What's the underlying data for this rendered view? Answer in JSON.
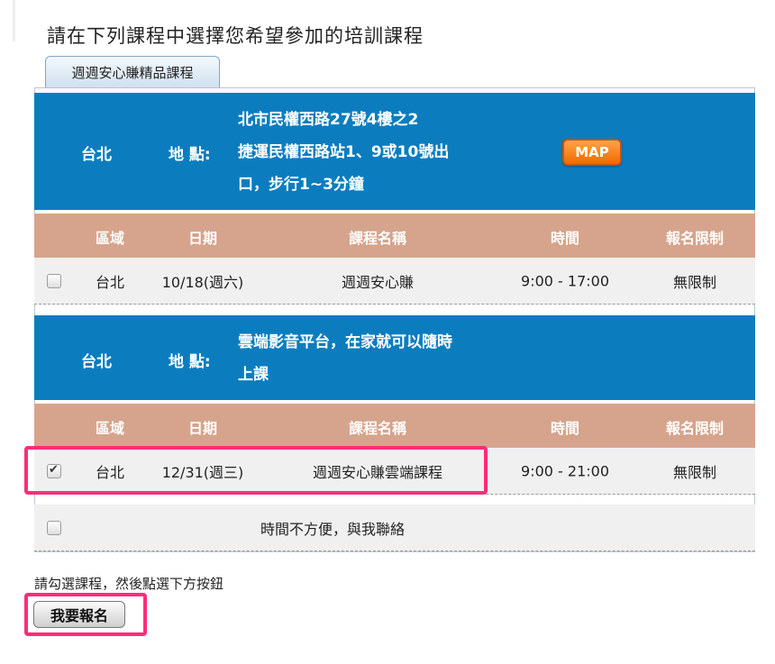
{
  "page_title": "請在下列課程中選擇您希望參加的培訓課程",
  "tab_label": "週週安心賺精品課程",
  "sessions": [
    {
      "city": "台北",
      "addr_label": "地 點:",
      "addr_lines": [
        "北市民權西路27號4樓之2",
        "捷運民權西路站1、9或10號出",
        "口，步行1~3分鐘"
      ],
      "map_label": "MAP",
      "headers": [
        "區域",
        "日期",
        "課程名稱",
        "時間",
        "報名限制"
      ],
      "row": {
        "region": "台北",
        "date": "10/18(週六)",
        "course": "週週安心賺",
        "time": "9:00 - 17:00",
        "limit": "無限制",
        "checked": false
      }
    },
    {
      "city": "台北",
      "addr_label": "地 點:",
      "addr_lines": [
        "雲端影音平台，在家就可以隨時",
        "上課"
      ],
      "headers": [
        "區域",
        "日期",
        "課程名稱",
        "時間",
        "報名限制"
      ],
      "row": {
        "region": "台北",
        "date": "12/31(週三)",
        "course": "週週安心賺雲端課程",
        "time": "9:00 - 21:00",
        "limit": "無限制",
        "checked": true
      }
    }
  ],
  "contact_row_label": "時間不方便，與我聯絡",
  "hint": "請勾選課程，然後點選下方按鈕",
  "submit_label": "我要報名",
  "colors": {
    "location_bar": "#0b7dbf",
    "header_bar": "#d6a48c",
    "highlight": "#ff2d79",
    "map_button": "#f07a10"
  }
}
